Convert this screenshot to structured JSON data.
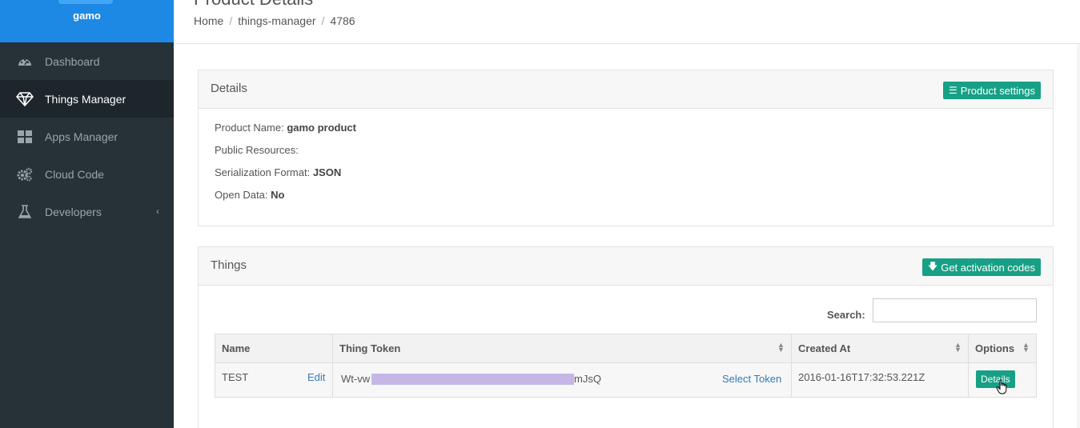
{
  "user": {
    "name": "gamo"
  },
  "sidebar": {
    "items": [
      {
        "label": "Dashboard",
        "icon": "dashboard-icon",
        "active": false
      },
      {
        "label": "Things Manager",
        "icon": "diamond-icon",
        "active": true
      },
      {
        "label": "Apps Manager",
        "icon": "grid-icon",
        "active": false
      },
      {
        "label": "Cloud Code",
        "icon": "gears-icon",
        "active": false
      },
      {
        "label": "Developers",
        "icon": "flask-icon",
        "active": false,
        "expandable": true
      }
    ]
  },
  "header": {
    "title": "Product Details",
    "breadcrumb": [
      "Home",
      "things-manager",
      "4786"
    ]
  },
  "details_panel": {
    "title": "Details",
    "settings_button": "Product settings",
    "product_name_label": "Product Name:",
    "product_name_value": "gamo product",
    "public_resources_label": "Public Resources:",
    "serialization_label": "Serialization Format:",
    "serialization_value": "JSON",
    "open_data_label": "Open Data:",
    "open_data_value": "No"
  },
  "things_panel": {
    "title": "Things",
    "activation_button": "Get activation codes",
    "search_label": "Search:",
    "search_value": "",
    "columns": [
      "Name",
      "Thing Token",
      "Created At",
      "Options"
    ],
    "rows": [
      {
        "name": "TEST",
        "edit_label": "Edit",
        "token_start": "Wt-vw",
        "token_end": "mJsQ",
        "select_label": "Select Token",
        "created_at": "2016-01-16T17:32:53.221Z",
        "details_label": "Details"
      }
    ]
  },
  "colors": {
    "sidebar_bg": "#263238",
    "sidebar_header": "#1e88e5",
    "accent_green": "#17a085",
    "link_blue": "#337ab7"
  }
}
